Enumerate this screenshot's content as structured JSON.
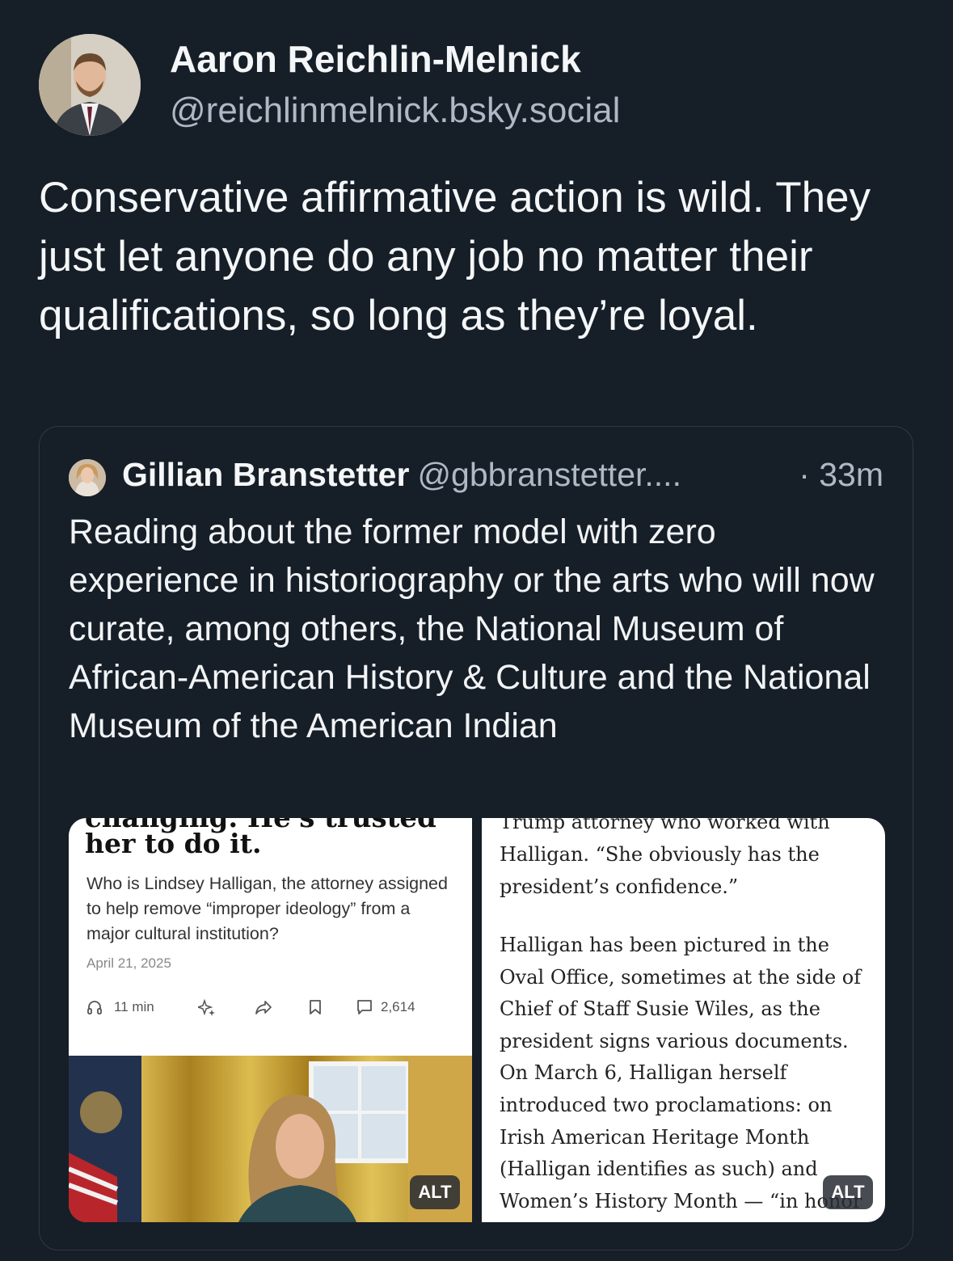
{
  "post": {
    "author_name": "Aaron Reichlin-Melnick",
    "author_handle": "@reichlinmelnick.bsky.social",
    "text": "Conservative affirmative action is wild. They just let anyone do any job no matter their qualifications, so long as they’re loyal."
  },
  "quote": {
    "author_name": "Gillian Branstetter",
    "author_handle": "@gbbranstetter....",
    "time": "· 33m",
    "text": "Reading about the former model with zero experience in historiography or the arts who will now curate, among others, the National Museum of African-American History & Culture and the National Museum of the American Indian",
    "image_left": {
      "clipped_top": "changing. He's trusted",
      "headline": "her to do it.",
      "subhead": "Who is Lindsey Halligan, the attorney assigned to help remove “improper ideology” from a major cultural institution?",
      "date": "April 21, 2025",
      "listen": "11 min",
      "comments": "2,614",
      "alt": "ALT"
    },
    "image_right": {
      "para1_clipped": "Trump attorney who worked with",
      "para1": "Halligan. “She obviously has the president’s confidence.”",
      "para2": "Halligan has been pictured in the Oval Office, sometimes at the side of Chief of Staff Susie Wiles, as the president signs various documents. On March 6, Halligan herself introduced two proclamations: on Irish American Heritage Month (Halligan identifies as such) and Women’s History Month — “in honor",
      "alt": "ALT"
    }
  },
  "colors": {
    "background": "#161e27",
    "handle": "#aeb9c6",
    "card_border": "#2e3a48"
  }
}
